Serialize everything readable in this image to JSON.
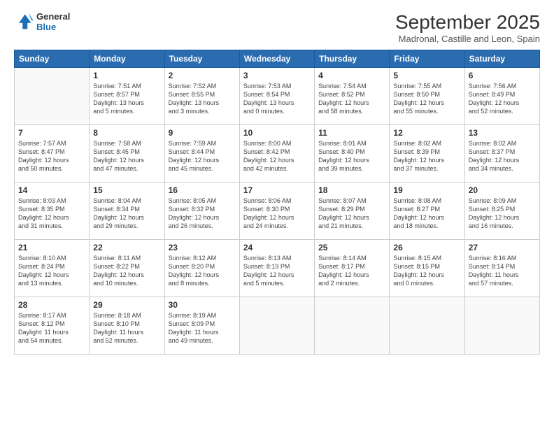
{
  "header": {
    "logo_line1": "General",
    "logo_line2": "Blue",
    "title": "September 2025",
    "subtitle": "Madronal, Castille and Leon, Spain"
  },
  "weekdays": [
    "Sunday",
    "Monday",
    "Tuesday",
    "Wednesday",
    "Thursday",
    "Friday",
    "Saturday"
  ],
  "weeks": [
    [
      {
        "num": "",
        "info": ""
      },
      {
        "num": "1",
        "info": "Sunrise: 7:51 AM\nSunset: 8:57 PM\nDaylight: 13 hours\nand 5 minutes."
      },
      {
        "num": "2",
        "info": "Sunrise: 7:52 AM\nSunset: 8:55 PM\nDaylight: 13 hours\nand 3 minutes."
      },
      {
        "num": "3",
        "info": "Sunrise: 7:53 AM\nSunset: 8:54 PM\nDaylight: 13 hours\nand 0 minutes."
      },
      {
        "num": "4",
        "info": "Sunrise: 7:54 AM\nSunset: 8:52 PM\nDaylight: 12 hours\nand 58 minutes."
      },
      {
        "num": "5",
        "info": "Sunrise: 7:55 AM\nSunset: 8:50 PM\nDaylight: 12 hours\nand 55 minutes."
      },
      {
        "num": "6",
        "info": "Sunrise: 7:56 AM\nSunset: 8:49 PM\nDaylight: 12 hours\nand 52 minutes."
      }
    ],
    [
      {
        "num": "7",
        "info": "Sunrise: 7:57 AM\nSunset: 8:47 PM\nDaylight: 12 hours\nand 50 minutes."
      },
      {
        "num": "8",
        "info": "Sunrise: 7:58 AM\nSunset: 8:45 PM\nDaylight: 12 hours\nand 47 minutes."
      },
      {
        "num": "9",
        "info": "Sunrise: 7:59 AM\nSunset: 8:44 PM\nDaylight: 12 hours\nand 45 minutes."
      },
      {
        "num": "10",
        "info": "Sunrise: 8:00 AM\nSunset: 8:42 PM\nDaylight: 12 hours\nand 42 minutes."
      },
      {
        "num": "11",
        "info": "Sunrise: 8:01 AM\nSunset: 8:40 PM\nDaylight: 12 hours\nand 39 minutes."
      },
      {
        "num": "12",
        "info": "Sunrise: 8:02 AM\nSunset: 8:39 PM\nDaylight: 12 hours\nand 37 minutes."
      },
      {
        "num": "13",
        "info": "Sunrise: 8:02 AM\nSunset: 8:37 PM\nDaylight: 12 hours\nand 34 minutes."
      }
    ],
    [
      {
        "num": "14",
        "info": "Sunrise: 8:03 AM\nSunset: 8:35 PM\nDaylight: 12 hours\nand 31 minutes."
      },
      {
        "num": "15",
        "info": "Sunrise: 8:04 AM\nSunset: 8:34 PM\nDaylight: 12 hours\nand 29 minutes."
      },
      {
        "num": "16",
        "info": "Sunrise: 8:05 AM\nSunset: 8:32 PM\nDaylight: 12 hours\nand 26 minutes."
      },
      {
        "num": "17",
        "info": "Sunrise: 8:06 AM\nSunset: 8:30 PM\nDaylight: 12 hours\nand 24 minutes."
      },
      {
        "num": "18",
        "info": "Sunrise: 8:07 AM\nSunset: 8:29 PM\nDaylight: 12 hours\nand 21 minutes."
      },
      {
        "num": "19",
        "info": "Sunrise: 8:08 AM\nSunset: 8:27 PM\nDaylight: 12 hours\nand 18 minutes."
      },
      {
        "num": "20",
        "info": "Sunrise: 8:09 AM\nSunset: 8:25 PM\nDaylight: 12 hours\nand 16 minutes."
      }
    ],
    [
      {
        "num": "21",
        "info": "Sunrise: 8:10 AM\nSunset: 8:24 PM\nDaylight: 12 hours\nand 13 minutes."
      },
      {
        "num": "22",
        "info": "Sunrise: 8:11 AM\nSunset: 8:22 PM\nDaylight: 12 hours\nand 10 minutes."
      },
      {
        "num": "23",
        "info": "Sunrise: 8:12 AM\nSunset: 8:20 PM\nDaylight: 12 hours\nand 8 minutes."
      },
      {
        "num": "24",
        "info": "Sunrise: 8:13 AM\nSunset: 8:19 PM\nDaylight: 12 hours\nand 5 minutes."
      },
      {
        "num": "25",
        "info": "Sunrise: 8:14 AM\nSunset: 8:17 PM\nDaylight: 12 hours\nand 2 minutes."
      },
      {
        "num": "26",
        "info": "Sunrise: 8:15 AM\nSunset: 8:15 PM\nDaylight: 12 hours\nand 0 minutes."
      },
      {
        "num": "27",
        "info": "Sunrise: 8:16 AM\nSunset: 8:14 PM\nDaylight: 11 hours\nand 57 minutes."
      }
    ],
    [
      {
        "num": "28",
        "info": "Sunrise: 8:17 AM\nSunset: 8:12 PM\nDaylight: 11 hours\nand 54 minutes."
      },
      {
        "num": "29",
        "info": "Sunrise: 8:18 AM\nSunset: 8:10 PM\nDaylight: 11 hours\nand 52 minutes."
      },
      {
        "num": "30",
        "info": "Sunrise: 8:19 AM\nSunset: 8:09 PM\nDaylight: 11 hours\nand 49 minutes."
      },
      {
        "num": "",
        "info": ""
      },
      {
        "num": "",
        "info": ""
      },
      {
        "num": "",
        "info": ""
      },
      {
        "num": "",
        "info": ""
      }
    ]
  ]
}
